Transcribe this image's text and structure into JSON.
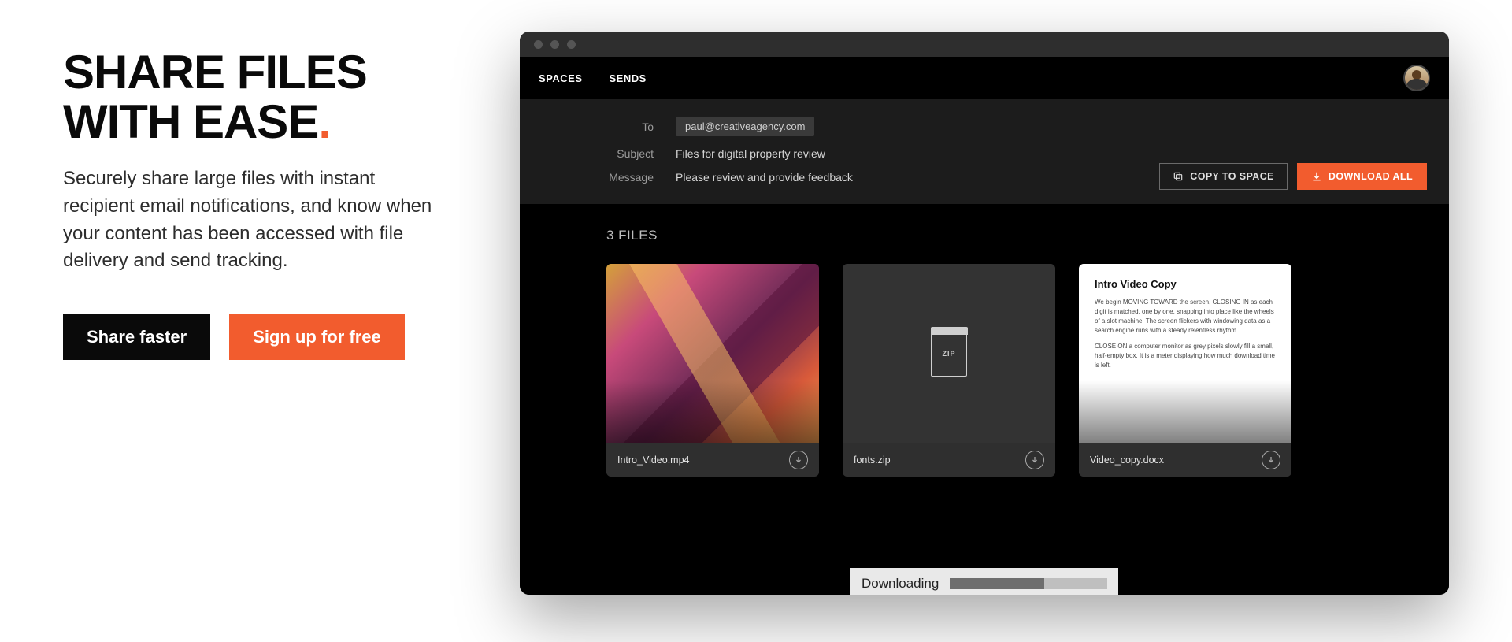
{
  "hero": {
    "headline_line1": "SHARE FILES",
    "headline_line2": "WITH EASE",
    "subhead": "Securely share large files with instant recipient email notifications, and know when your content has been accessed with file delivery and send tracking.",
    "btn_primary": "Share faster",
    "btn_secondary": "Sign up for free"
  },
  "app": {
    "nav": {
      "tab1": "SPACES",
      "tab2": "SENDS"
    },
    "form": {
      "to_label": "To",
      "to_value": "paul@creativeagency.com",
      "subject_label": "Subject",
      "subject_value": "Files for digital property review",
      "message_label": "Message",
      "message_value": "Please review and provide feedback"
    },
    "actions": {
      "copy": "COPY TO SPACE",
      "download": "DOWNLOAD ALL"
    },
    "files": {
      "heading": "3 FILES",
      "zip_badge": "ZIP",
      "items": [
        {
          "name": "Intro_Video.mp4"
        },
        {
          "name": "fonts.zip"
        },
        {
          "name": "Video_copy.docx"
        }
      ],
      "doc_preview": {
        "title": "Intro Video Copy",
        "p1": "We begin MOVING TOWARD the screen, CLOSING IN as each digit is matched, one by one, snapping into place like the wheels of a slot machine. The screen flickers with windowing data as a search engine runs with a steady relentless rhythm.",
        "p2": "CLOSE ON a computer monitor as grey pixels slowly fill a small, half-empty box. It is a meter displaying how much download time is left."
      }
    },
    "progress": {
      "label": "Downloading"
    }
  },
  "colors": {
    "accent": "#f25c2e"
  }
}
